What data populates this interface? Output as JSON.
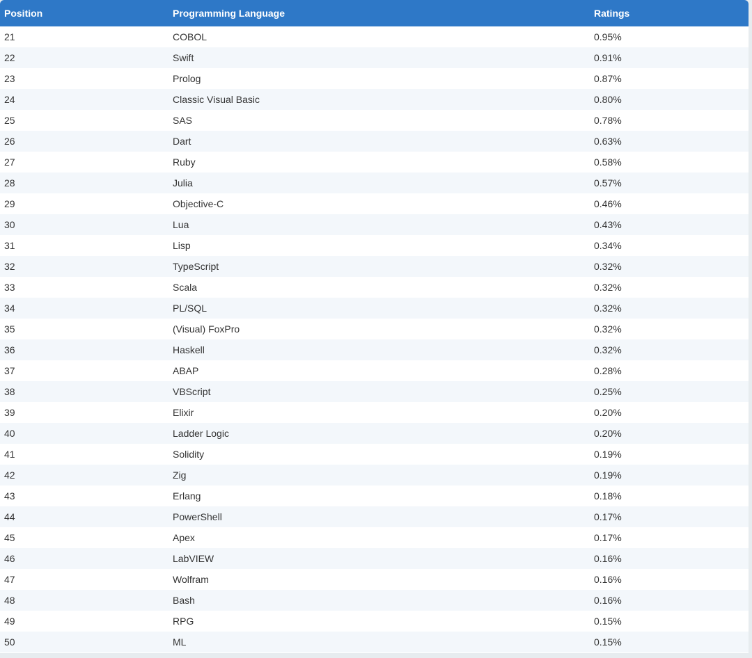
{
  "table": {
    "headers": {
      "position": "Position",
      "language": "Programming Language",
      "ratings": "Ratings"
    },
    "rows": [
      {
        "position": "21",
        "language": "COBOL",
        "rating": "0.95%"
      },
      {
        "position": "22",
        "language": "Swift",
        "rating": "0.91%"
      },
      {
        "position": "23",
        "language": "Prolog",
        "rating": "0.87%"
      },
      {
        "position": "24",
        "language": "Classic Visual Basic",
        "rating": "0.80%"
      },
      {
        "position": "25",
        "language": "SAS",
        "rating": "0.78%"
      },
      {
        "position": "26",
        "language": "Dart",
        "rating": "0.63%"
      },
      {
        "position": "27",
        "language": "Ruby",
        "rating": "0.58%"
      },
      {
        "position": "28",
        "language": "Julia",
        "rating": "0.57%"
      },
      {
        "position": "29",
        "language": "Objective-C",
        "rating": "0.46%"
      },
      {
        "position": "30",
        "language": "Lua",
        "rating": "0.43%"
      },
      {
        "position": "31",
        "language": "Lisp",
        "rating": "0.34%"
      },
      {
        "position": "32",
        "language": "TypeScript",
        "rating": "0.32%"
      },
      {
        "position": "33",
        "language": "Scala",
        "rating": "0.32%"
      },
      {
        "position": "34",
        "language": "PL/SQL",
        "rating": "0.32%"
      },
      {
        "position": "35",
        "language": "(Visual) FoxPro",
        "rating": "0.32%"
      },
      {
        "position": "36",
        "language": "Haskell",
        "rating": "0.32%"
      },
      {
        "position": "37",
        "language": "ABAP",
        "rating": "0.28%"
      },
      {
        "position": "38",
        "language": "VBScript",
        "rating": "0.25%"
      },
      {
        "position": "39",
        "language": "Elixir",
        "rating": "0.20%"
      },
      {
        "position": "40",
        "language": "Ladder Logic",
        "rating": "0.20%"
      },
      {
        "position": "41",
        "language": "Solidity",
        "rating": "0.19%"
      },
      {
        "position": "42",
        "language": "Zig",
        "rating": "0.19%"
      },
      {
        "position": "43",
        "language": "Erlang",
        "rating": "0.18%"
      },
      {
        "position": "44",
        "language": "PowerShell",
        "rating": "0.17%"
      },
      {
        "position": "45",
        "language": "Apex",
        "rating": "0.17%"
      },
      {
        "position": "46",
        "language": "LabVIEW",
        "rating": "0.16%"
      },
      {
        "position": "47",
        "language": "Wolfram",
        "rating": "0.16%"
      },
      {
        "position": "48",
        "language": "Bash",
        "rating": "0.16%"
      },
      {
        "position": "49",
        "language": "RPG",
        "rating": "0.15%"
      },
      {
        "position": "50",
        "language": "ML",
        "rating": "0.15%"
      }
    ]
  },
  "colors": {
    "header_bg": "#2e78c7",
    "row_alt_bg": "#f3f7fb",
    "page_bg": "#e7ecef"
  }
}
